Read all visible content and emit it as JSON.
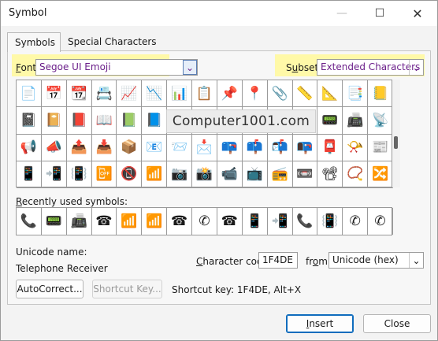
{
  "window": {
    "title": "Symbol"
  },
  "tabs": [
    {
      "label": "Symbols"
    },
    {
      "label": "Special Characters"
    }
  ],
  "font": {
    "label": "Font:",
    "value": "Segoe UI Emoji"
  },
  "subset": {
    "label": "Subset:",
    "value": "Extended Characters - P"
  },
  "symbol_grid": {
    "rows": [
      [
        "📄",
        "📅",
        "📆",
        "📇",
        "📈",
        "📉",
        "📊",
        "📋",
        "📌",
        "📍",
        "📎",
        "📏",
        "📐",
        "📑",
        "📒"
      ],
      [
        "📓",
        "📔",
        "📕",
        "📖",
        "📗",
        "📘",
        "📙",
        "📚",
        "📛",
        "📜",
        "📝",
        "📞",
        "📟",
        "📠",
        "📡"
      ],
      [
        "📢",
        "📣",
        "📤",
        "📥",
        "📦",
        "📧",
        "📨",
        "📩",
        "📪",
        "📫",
        "📬",
        "📭",
        "📮",
        "📯",
        "📰"
      ],
      [
        "📱",
        "📲",
        "📳",
        "📴",
        "📵",
        "📶",
        "📷",
        "📸",
        "📹",
        "📺",
        "📻",
        "📼",
        "📽",
        "📿",
        "🔀"
      ]
    ]
  },
  "watermark": "Computer1001.com",
  "recent": {
    "label": "Recently used symbols:",
    "symbols": [
      "📞",
      "📟",
      "📠",
      "☎",
      "📶",
      "📶",
      "☎",
      "✆",
      "☎",
      "📱",
      "📲",
      "📞",
      "📳",
      "✆",
      "✆"
    ]
  },
  "info": {
    "unicode_name_label": "Unicode name:",
    "unicode_name": "Telephone Receiver",
    "char_code_label": "Character code:",
    "char_code": "1F4DE",
    "from_label": "from:",
    "from_value": "Unicode (hex)",
    "shortcut_text": "Shortcut key: 1F4DE, Alt+X"
  },
  "buttons": {
    "autocorrect": "AutoCorrect...",
    "shortcut_key": "Shortcut Key...",
    "insert": "Insert",
    "close": "Close"
  }
}
